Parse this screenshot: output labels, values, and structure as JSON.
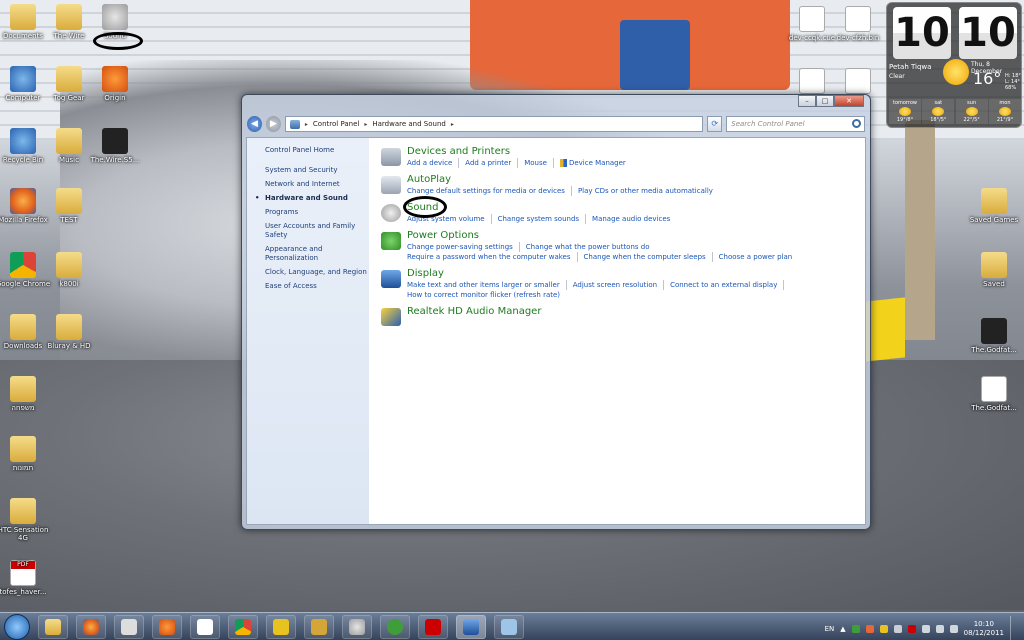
{
  "desktop": {
    "icons": [
      {
        "label": "Documents",
        "icon": "folder-icon"
      },
      {
        "label": "The Wire",
        "icon": "folder-icon"
      },
      {
        "label": "Sound",
        "icon": "speaker-icon"
      },
      {
        "label": "Computer",
        "icon": "computer-icon"
      },
      {
        "label": "Tog Gear",
        "icon": "folder-icon"
      },
      {
        "label": "Origin",
        "icon": "origin-icon"
      },
      {
        "label": "Recycle Bin",
        "icon": "recycle-bin-icon"
      },
      {
        "label": "Music",
        "icon": "folder-icon"
      },
      {
        "label": "The.Wire.S5...",
        "icon": "video-icon"
      },
      {
        "label": "Mozilla Firefox",
        "icon": "firefox-icon"
      },
      {
        "label": "TEST",
        "icon": "folder-icon"
      },
      {
        "label": "Google Chrome",
        "icon": "chrome-icon"
      },
      {
        "label": "k800i",
        "icon": "folder-icon"
      },
      {
        "label": "Downloads",
        "icon": "folder-icon"
      },
      {
        "label": "Bluray & HD",
        "icon": "folder-icon"
      },
      {
        "label": "משפחה",
        "icon": "folder-icon"
      },
      {
        "label": "תמונות",
        "icon": "folder-icon"
      },
      {
        "label": "HTC Sensation 4G",
        "icon": "folder-icon"
      },
      {
        "label": "tofes_haver...",
        "icon": "pdf-icon"
      },
      {
        "label": "dev-ccqk.cue",
        "icon": "document-icon"
      },
      {
        "label": "dev-cfzh.bin",
        "icon": "document-icon"
      },
      {
        "label": "Saved Games",
        "icon": "folder-icon"
      },
      {
        "label": "Saved",
        "icon": "folder-icon"
      },
      {
        "label": "The.Godfat...",
        "icon": "video-icon"
      },
      {
        "label": "The.Godfat...",
        "icon": "document-icon"
      }
    ]
  },
  "gadget": {
    "hours": "10",
    "minutes": "10",
    "city": "Petah Tiqwa",
    "condition": "Clear",
    "date": "Thu, 8 December",
    "temperature": "16°",
    "high": "H: 18°",
    "low": "L: 14°",
    "humidity": "68%",
    "forecast": [
      {
        "day": "tomorrow",
        "temps": "19°/8°"
      },
      {
        "day": "sat",
        "temps": "18°/5°"
      },
      {
        "day": "sun",
        "temps": "22°/5°"
      },
      {
        "day": "mon",
        "temps": "21°/9°"
      }
    ]
  },
  "window": {
    "caption": {
      "minimize": "–",
      "maximize": "□",
      "close": "✕"
    },
    "breadcrumb": [
      "Control Panel",
      "Hardware and Sound"
    ],
    "search_placeholder": "Search Control Panel",
    "left_nav": {
      "home": "Control Panel Home",
      "items": [
        "System and Security",
        "Network and Internet",
        "Hardware and Sound",
        "Programs",
        "User Accounts and Family Safety",
        "Appearance and Personalization",
        "Clock, Language, and Region",
        "Ease of Access"
      ],
      "current_index": 2
    },
    "categories": [
      {
        "title": "Devices and Printers",
        "icon": "printer-icon",
        "links": [
          "Add a device",
          "Add a printer",
          "Mouse",
          "Device Manager"
        ]
      },
      {
        "title": "AutoPlay",
        "icon": "autoplay-icon",
        "links": [
          "Change default settings for media or devices",
          "Play CDs or other media automatically"
        ]
      },
      {
        "title": "Sound",
        "icon": "sound-icon",
        "links": [
          "Adjust system volume",
          "Change system sounds",
          "Manage audio devices"
        ]
      },
      {
        "title": "Power Options",
        "icon": "power-options-icon",
        "links": [
          "Change power-saving settings",
          "Change what the power buttons do",
          "Require a password when the computer wakes",
          "Change when the computer sleeps",
          "Choose a power plan"
        ]
      },
      {
        "title": "Display",
        "icon": "display-icon",
        "links": [
          "Make text and other items larger or smaller",
          "Adjust screen resolution",
          "Connect to an external display",
          "How to correct monitor flicker (refresh rate)"
        ]
      },
      {
        "title": "Realtek HD Audio Manager",
        "icon": "realtek-icon",
        "links": []
      }
    ]
  },
  "taskbar": {
    "language": "EN",
    "time": "10:10",
    "date": "08/12/2011"
  },
  "colors": {
    "link": "#1a56b8",
    "category_title": "#1e7b1e",
    "nav_link": "#1d3f7a"
  }
}
